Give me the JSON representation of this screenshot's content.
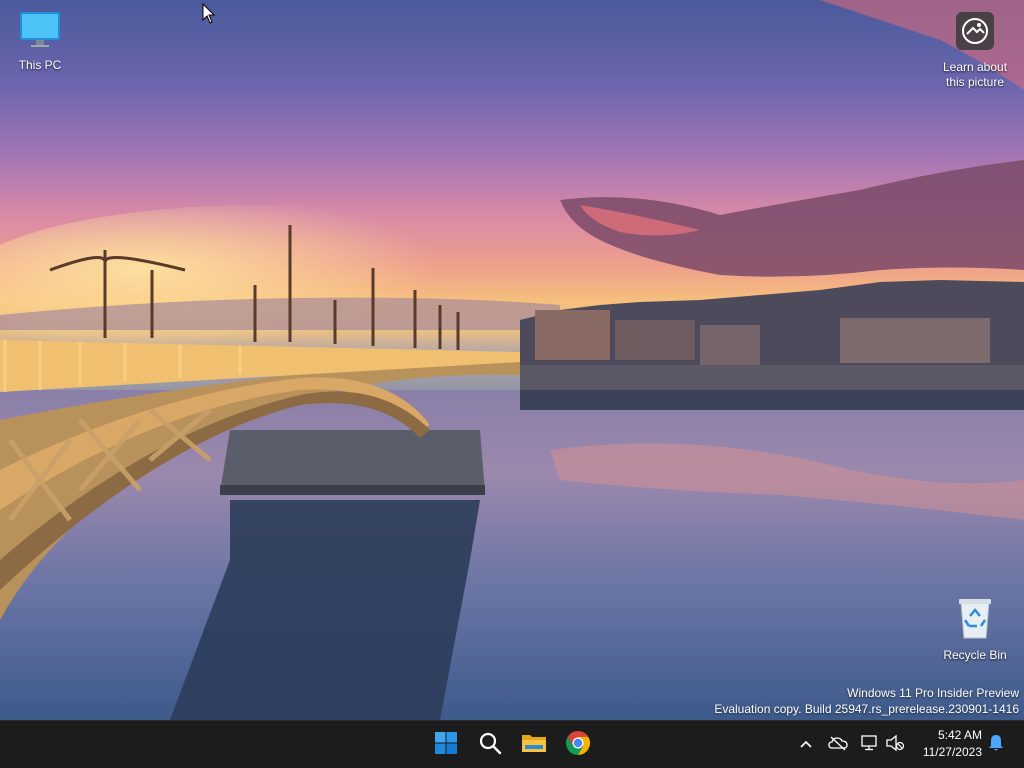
{
  "desktop": {
    "icons": [
      {
        "label": "This PC",
        "icon": "monitor-icon"
      },
      {
        "label": "Learn about this picture",
        "icon": "camera-icon"
      },
      {
        "label": "Recycle Bin",
        "icon": "recycle-bin-icon"
      }
    ],
    "watermark": {
      "line1": "Windows 11 Pro Insider Preview",
      "line2": "Evaluation copy. Build 25947.rs_prerelease.230901-1416"
    }
  },
  "taskbar": {
    "apps": [
      {
        "name": "Start",
        "icon": "windows-logo-icon"
      },
      {
        "name": "Search",
        "icon": "search-icon"
      },
      {
        "name": "File Explorer",
        "icon": "folder-icon"
      },
      {
        "name": "Google Chrome",
        "icon": "chrome-icon"
      }
    ],
    "tray": {
      "icons": [
        "chevron-up-icon",
        "cloud-offline-icon",
        "network-icon",
        "volume-muted-icon",
        "notification-bell-icon"
      ]
    },
    "clock": {
      "time": "5:42 AM",
      "date": "11/27/2023"
    }
  },
  "colors": {
    "taskbar_bg": "#1c1c1c",
    "windows_blue": "#0078d4",
    "folder_yellow": "#f8c23b"
  }
}
